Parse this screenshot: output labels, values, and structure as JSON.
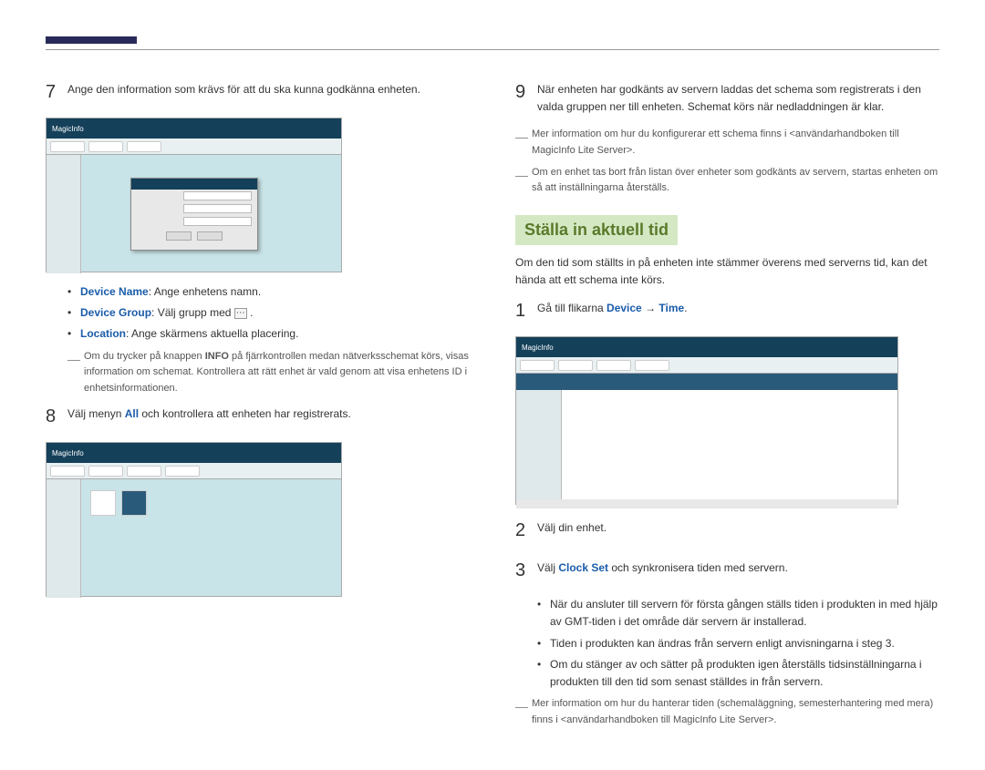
{
  "left": {
    "step7": {
      "num": "7",
      "text": "Ange den information som krävs för att du ska kunna godkänna enheten."
    },
    "bullets": {
      "deviceName_kw": "Device Name",
      "deviceName_txt": ": Ange enhetens namn.",
      "deviceGroup_kw": "Device Group",
      "deviceGroup_txt": ": Välj grupp med ",
      "deviceGroup_txt2": " .",
      "location_kw": "Location",
      "location_txt": ": Ange skärmens aktuella placering."
    },
    "note1_pre": "Om du trycker på knappen ",
    "note1_bold": "INFO",
    "note1_post": " på fjärrkontrollen medan nätverksschemat körs, visas information om schemat. Kontrollera att rätt enhet är vald genom att visa enhetens ID i enhetsinformationen.",
    "step8": {
      "num": "8",
      "pre": "Välj menyn ",
      "kw": "All",
      "post": " och kontrollera att enheten har registrerats."
    }
  },
  "right": {
    "step9": {
      "num": "9",
      "text": "När enheten har godkänts av servern laddas det schema som registrerats i den valda gruppen ner till enheten. Schemat körs när nedladdningen är klar."
    },
    "note_a": "Mer information om hur du konfigurerar ett schema finns i <användarhandboken till MagicInfo Lite Server>.",
    "note_b": "Om en enhet tas bort från listan över enheter som godkänts av servern, startas enheten om så att inställningarna återställs.",
    "section_title": "Ställa in aktuell tid",
    "intro": "Om den tid som ställts in på enheten inte stämmer överens med serverns tid, kan det hända att ett schema inte körs.",
    "step1": {
      "num": "1",
      "pre": "Gå till flikarna ",
      "kw1": "Device",
      "arrow": " → ",
      "kw2": "Time",
      "post": "."
    },
    "step2": {
      "num": "2",
      "text": "Välj din enhet."
    },
    "step3": {
      "num": "3",
      "pre": "Välj ",
      "kw": "Clock Set",
      "post": " och synkronisera tiden med servern."
    },
    "bullets2": {
      "b1": "När du ansluter till servern för första gången ställs tiden i produkten in med hjälp av GMT-tiden i det område där servern är installerad.",
      "b2": "Tiden i produkten kan ändras från servern enligt anvisningarna i steg 3.",
      "b3": "Om du stänger av och sätter på produkten igen återställs tidsinställningarna i produkten till den tid som senast ställdes in från servern."
    },
    "note_c": "Mer information om hur du hanterar tiden (schemaläggning, semesterhantering med mera) finns i <användarhandboken till MagicInfo Lite Server>."
  },
  "screenshot_logo": "MagicInfo"
}
